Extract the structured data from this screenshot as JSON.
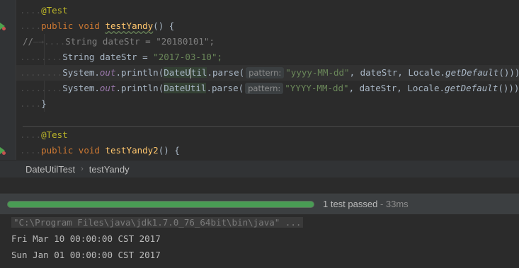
{
  "editor": {
    "lines": {
      "annotation1": "@Test",
      "kw_public": "public",
      "kw_void": "void",
      "method1": "testYandy",
      "paren_open": "() {",
      "comment_prefix": "//",
      "string_kw": "String",
      "datestr_var": "dateStr",
      "assign": " = ",
      "str_commented": "\"20180101\";",
      "str_active": "\"2017-03-10\";",
      "system": "System.",
      "out": "out",
      "println": ".println(",
      "dateutil_a": "DateU",
      "dateutil_b": "til",
      "dateutil_full": "DateUtil",
      "parse": ".parse(",
      "hint_pattern": "pattern:",
      "pattern_lower": "\"yyyy-MM-dd\"",
      "pattern_upper": "\"YYYY-MM-dd\"",
      "args_rest": ", dateStr, Locale.",
      "get_default": "getDefault",
      "close": "()));",
      "brace_close": "}",
      "annotation2": "@Test",
      "method2": "testYandy2",
      "paren_open2": "() {"
    }
  },
  "breadcrumb": {
    "class_name": "DateUtilTest",
    "method_name": "testYandy"
  },
  "run": {
    "progress_fraction": 1.0,
    "status": "1 test passed",
    "time": " - 33ms",
    "accent": "#499c54"
  },
  "console": {
    "command": "\"C:\\Program Files\\java\\jdk1.7.0_76_64bit\\bin\\java\" ...",
    "output": [
      "Fri Mar 10 00:00:00 CST 2017",
      "Sun Jan 01 00:00:00 CST 2017"
    ]
  }
}
